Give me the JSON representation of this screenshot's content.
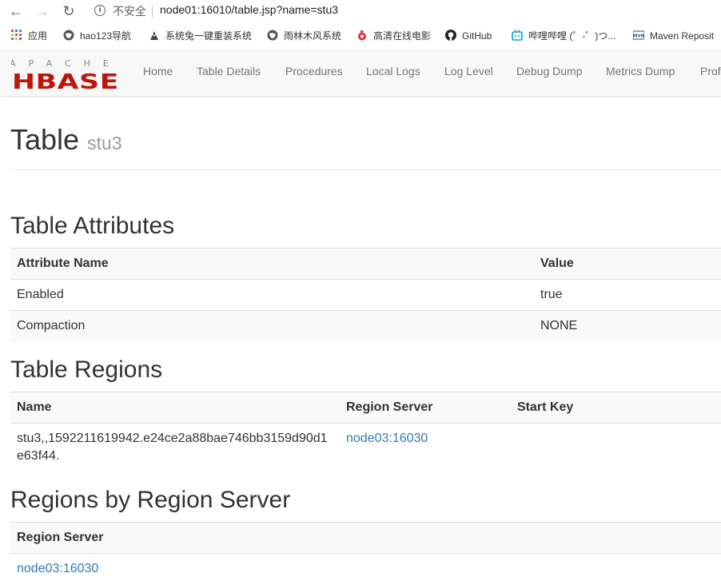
{
  "browser": {
    "security_label": "不安全",
    "url": "node01:16010/table.jsp?name=stu3",
    "bookmarks": [
      {
        "label": "应用",
        "icon": "apps-grid-icon"
      },
      {
        "label": "hao123导航",
        "icon": "globe-icon"
      },
      {
        "label": "系统兔一键重装系统",
        "icon": "rabbit-icon"
      },
      {
        "label": "雨林木风系统",
        "icon": "globe-icon"
      },
      {
        "label": "高清在线电影",
        "icon": "video-icon"
      },
      {
        "label": "GitHub",
        "icon": "github-icon"
      },
      {
        "label": "哔哩哔哩 (゜-゜)つ...",
        "icon": "bilibili-icon"
      },
      {
        "label": "Maven Reposit",
        "icon": "maven-icon"
      }
    ]
  },
  "navbar": {
    "logo_top": "APACHE",
    "logo_bottom": "HBASE",
    "links": [
      "Home",
      "Table Details",
      "Procedures",
      "Local Logs",
      "Log Level",
      "Debug Dump",
      "Metrics Dump",
      "Prof"
    ]
  },
  "page": {
    "title": "Table",
    "table_name": "stu3"
  },
  "attributes": {
    "heading": "Table Attributes",
    "columns": [
      "Attribute Name",
      "Value"
    ],
    "rows": [
      {
        "name": "Enabled",
        "value": "true"
      },
      {
        "name": "Compaction",
        "value": "NONE"
      }
    ]
  },
  "regions": {
    "heading": "Table Regions",
    "columns": [
      "Name",
      "Region Server",
      "Start Key"
    ],
    "rows": [
      {
        "name": "stu3,,1592211619942.e24ce2a88bae746bb3159d90d1e63f44.",
        "server": "node03:16030",
        "start_key": ""
      }
    ]
  },
  "by_server": {
    "heading": "Regions by Region Server",
    "columns": [
      "Region Server"
    ],
    "rows": [
      {
        "server": "node03:16030"
      }
    ]
  },
  "colors": {
    "link": "#337ab7",
    "logo_red": "#ba160c",
    "nav_text": "#777777"
  }
}
